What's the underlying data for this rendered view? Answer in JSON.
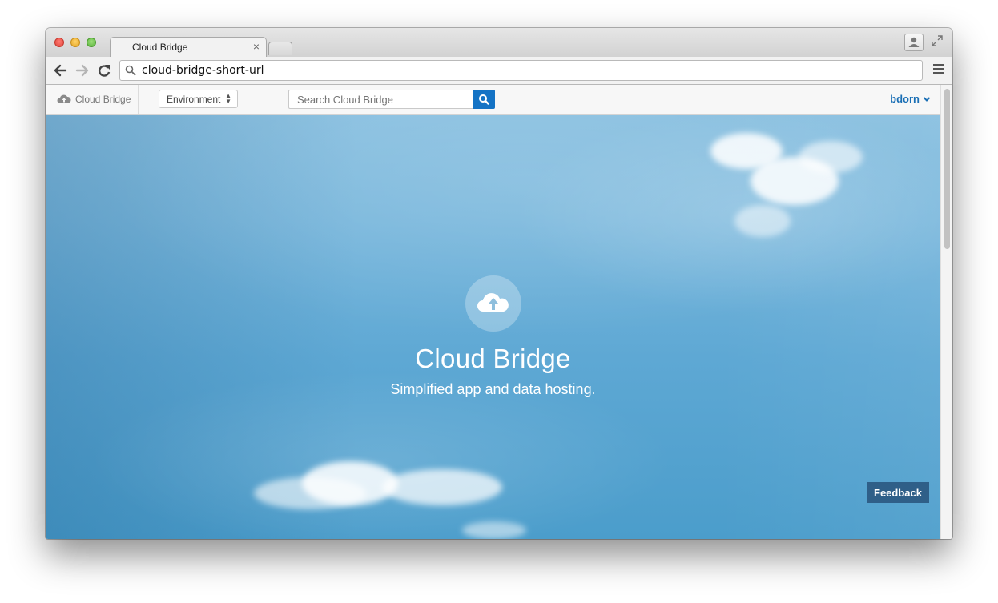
{
  "browser": {
    "tab_title": "Cloud Bridge",
    "tab_close": "×",
    "url": "cloud-bridge-short-url"
  },
  "app": {
    "brand_label": "Cloud Bridge",
    "environment_select": "Environment",
    "search_placeholder": "Search Cloud Bridge",
    "user_name": "bdorn"
  },
  "hero": {
    "title": "Cloud Bridge",
    "subtitle": "Simplified app and data hosting."
  },
  "feedback_label": "Feedback",
  "colors": {
    "accent": "#1473c5",
    "feedback": "#2f5f88",
    "user_link": "#1a6fb5"
  },
  "icons": {
    "brand": "cloud-icon",
    "search": "search-icon",
    "hero": "cloud-upload-icon",
    "user_dropdown": "chevron-down-icon"
  }
}
